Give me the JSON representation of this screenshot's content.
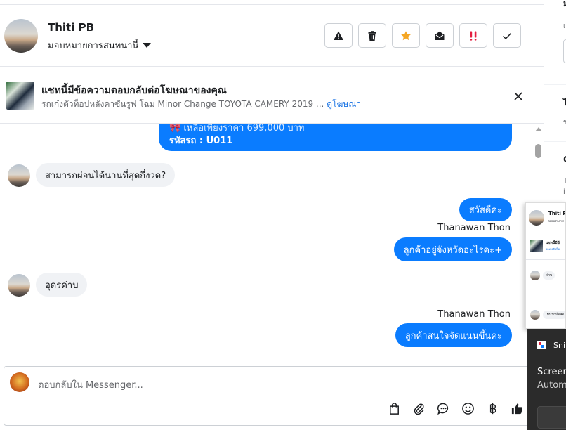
{
  "header": {
    "contact_name": "Thiti PB",
    "assign_label": "มอบหมายการสนทนานี้"
  },
  "ad_banner": {
    "title": "แชทนี้มีข้อความตอบกลับต่อโฆษณาของคุณ",
    "subtitle": "รถเก๋งตัวท็อปหลังคาซันรูฟ โฉม Minor Change TOYOTA CAMERY 2019 ...",
    "link": "ดูโฆษณา"
  },
  "messages": {
    "partial_line1": "🎀 เหลือเพียงราคา 699,000 บาท",
    "partial_line2": "รหัสรถ : U011",
    "in_1": "สามารถผ่อนได้นานที่สุดกี่งวด?",
    "out_1": "สวัสดีคะ",
    "sender_1": "Thanawan Thon",
    "out_2": "ลูกค้าอยู่จังหวัดอะไรคะ+",
    "in_2": "อุดรค่าบ",
    "sender_2": "Thanawan Thon",
    "out_3": "ลูกค้าสนใจจัดแนนขึ้นคะ"
  },
  "composer": {
    "placeholder": "ตอบกลับใน Messenger..."
  },
  "overlay": {
    "name": "Thiti PB",
    "sub": "มอบหมาย",
    "ad": "แชทนี้มีข้",
    "ad2": "รถเก๋งตัวท็อ",
    "msg1": "ค่าบ",
    "msg2": "เปนรถมือสอ"
  },
  "notification": {
    "app": "Sni",
    "line1": "Screen",
    "line2": "Autom"
  },
  "side_panel": {
    "letters": [
      "ม",
      "เ",
      "ไ",
      "ข",
      "C",
      "T",
      "i"
    ]
  },
  "colors": {
    "outgoing_bubble": "#0a7cff",
    "incoming_bubble": "#f0f2f5",
    "link": "#1b74e4",
    "star": "#f5a623",
    "alert": "#e41e3f"
  }
}
